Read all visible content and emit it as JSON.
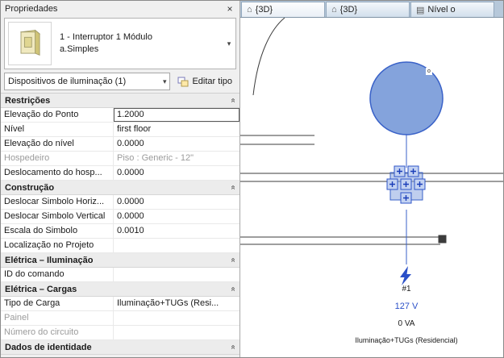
{
  "panel": {
    "title": "Propriedades",
    "close_glyph": "×",
    "chevron_glyph": "«",
    "dropdown_glyph": "▾",
    "type_selector": {
      "line1": "1 - Interruptor 1 Módulo",
      "line2": "a.Simples"
    },
    "filter_value": "Dispositivos de iluminação (1)",
    "edit_type_label": "Editar tipo",
    "sections": [
      {
        "title": "Restrições",
        "rows": [
          {
            "label": "Elevação do Ponto",
            "value": "1.2000",
            "selected": true
          },
          {
            "label": "Nível",
            "value": "first floor"
          },
          {
            "label": "Elevação do nível",
            "value": "0.0000"
          },
          {
            "label": "Hospedeiro",
            "value": "Piso : Generic - 12\"",
            "gray": true
          },
          {
            "label": "Deslocamento do hosp...",
            "value": "0.0000"
          }
        ]
      },
      {
        "title": "Construção",
        "rows": [
          {
            "label": "Deslocar Simbolo Horiz...",
            "value": "0.0000"
          },
          {
            "label": "Deslocar Simbolo Vertical",
            "value": "0.0000"
          },
          {
            "label": "Escala do Simbolo",
            "value": "0.0010"
          },
          {
            "label": "Localização no Projeto",
            "value": ""
          }
        ]
      },
      {
        "title": "Elétrica – Iluminação",
        "rows": [
          {
            "label": "ID do comando",
            "value": ""
          }
        ]
      },
      {
        "title": "Elétrica – Cargas",
        "rows": [
          {
            "label": "Tipo de Carga",
            "value": "Iluminação+TUGs (Resi..."
          },
          {
            "label": "Painel",
            "value": "",
            "gray": true
          },
          {
            "label": "Número do circuito",
            "value": "",
            "gray": true
          }
        ]
      },
      {
        "title": "Dados de identidade",
        "rows": []
      }
    ]
  },
  "view": {
    "tabs": [
      {
        "label": "{3D}",
        "icon_glyph": "⌂",
        "icon_name": "3d-view-icon",
        "active": true
      },
      {
        "label": "{3D}",
        "icon_glyph": "⌂",
        "icon_name": "3d-view-icon",
        "active": false
      },
      {
        "label": "Nível o",
        "icon_glyph": "▤",
        "icon_name": "plan-view-icon",
        "active": false
      }
    ]
  },
  "canvas": {
    "fixture_tag": "o",
    "circuit_number": "#1",
    "voltage": "127 V",
    "apparent_load": "0 VA",
    "load_classification": "Iluminação+TUGs (Residencial)",
    "selection_color": "#3a62c8",
    "fixture_fill": "#6e93d6"
  }
}
